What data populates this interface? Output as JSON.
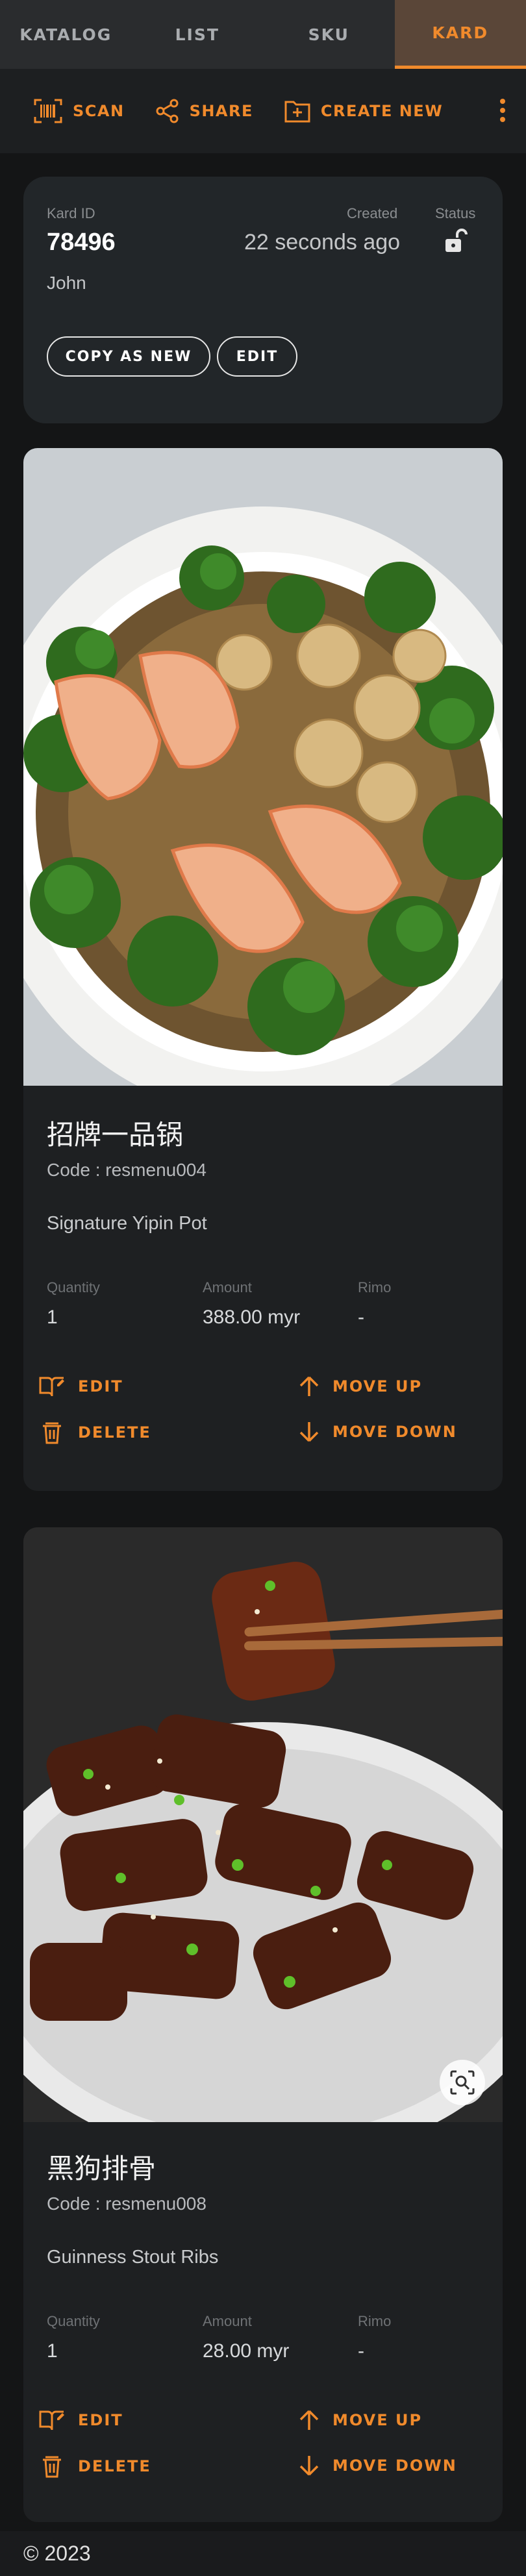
{
  "tabs": [
    {
      "label": "KATALOG",
      "active": false
    },
    {
      "label": "LIST",
      "active": false
    },
    {
      "label": "SKU",
      "active": false
    },
    {
      "label": "KARD",
      "active": true
    }
  ],
  "toolbar": {
    "scan_label": "SCAN",
    "share_label": "SHARE",
    "create_label": "CREATE NEW",
    "more_icon": "more-vert-icon"
  },
  "kard": {
    "id_label": "Kard ID",
    "id_value": "78496",
    "created_label": "Created",
    "created_value": "22 seconds ago",
    "status_label": "Status",
    "status_icon": "unlock-icon",
    "owner": "John",
    "copy_label": "COPY AS NEW",
    "edit_label": "EDIT"
  },
  "items": [
    {
      "name": "招牌一品锅",
      "code": "Code : resmenu004",
      "description": "Signature Yipin Pot",
      "quantity_label": "Quantity",
      "quantity": "1",
      "amount_label": "Amount",
      "amount": "388.00 myr",
      "rimo_label": "Rimo",
      "rimo": "-",
      "edit_label": "EDIT",
      "delete_label": "DELETE",
      "move_up_label": "MOVE UP",
      "move_down_label": "MOVE DOWN"
    },
    {
      "name": "黑狗排骨",
      "code": "Code : resmenu008",
      "description": "Guinness Stout Ribs",
      "quantity_label": "Quantity",
      "quantity": "1",
      "amount_label": "Amount",
      "amount": "28.00 myr",
      "rimo_label": "Rimo",
      "rimo": "-",
      "edit_label": "EDIT",
      "delete_label": "DELETE",
      "move_up_label": "MOVE UP",
      "move_down_label": "MOVE DOWN"
    }
  ],
  "footer": {
    "text": "© 2023"
  },
  "colors": {
    "accent": "#f08a2c",
    "background": "#141516",
    "card": "#1e2022"
  }
}
